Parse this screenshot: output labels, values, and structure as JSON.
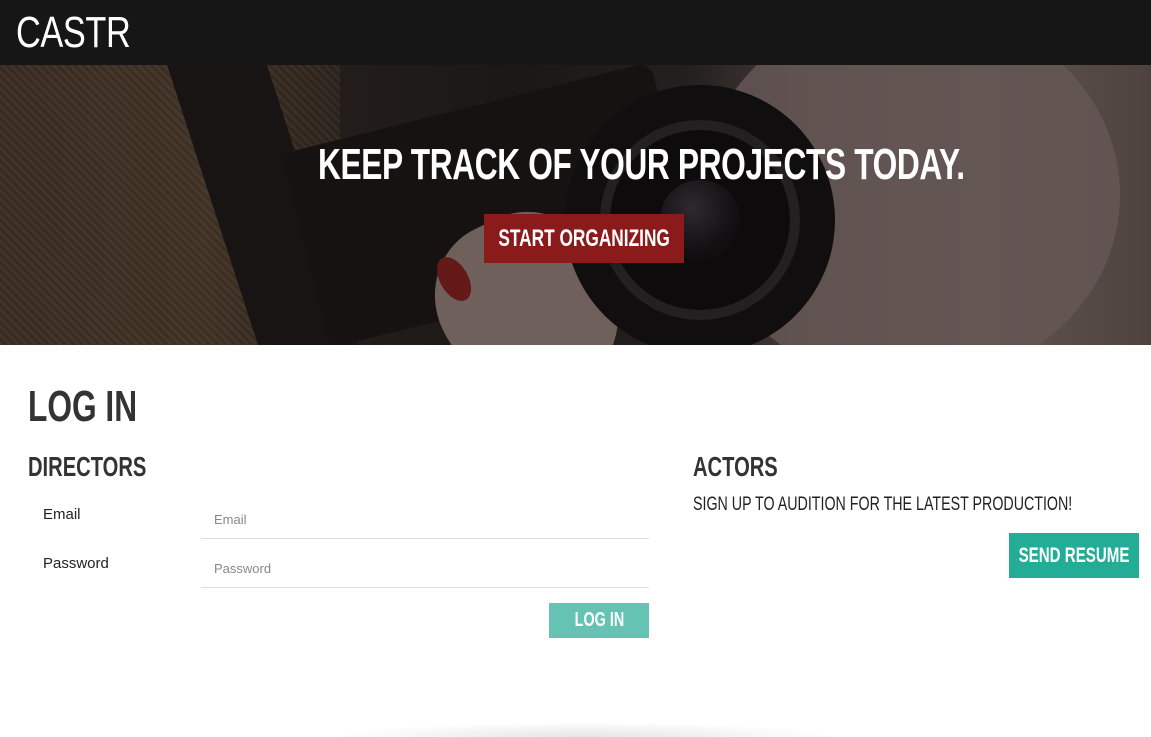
{
  "navbar": {
    "brand": "CASTR"
  },
  "hero": {
    "title": "KEEP TRACK OF YOUR PROJECTS TODAY.",
    "cta_label": "START ORGANIZING"
  },
  "login": {
    "title": "LOG IN",
    "directors": {
      "title": "DIRECTORS",
      "email_label": "Email",
      "email_placeholder": "Email",
      "password_label": "Password",
      "password_placeholder": "Password",
      "submit_label": "LOG IN"
    },
    "actors": {
      "title": "ACTORS",
      "text": "SIGN UP TO AUDITION FOR THE LATEST PRODUCTION!",
      "button_label": "SEND RESUME"
    }
  },
  "colors": {
    "navbar_bg": "#161616",
    "cta_red": "#8b1a1a",
    "login_teal": "#66c2b2",
    "resume_teal": "#23ad96"
  }
}
